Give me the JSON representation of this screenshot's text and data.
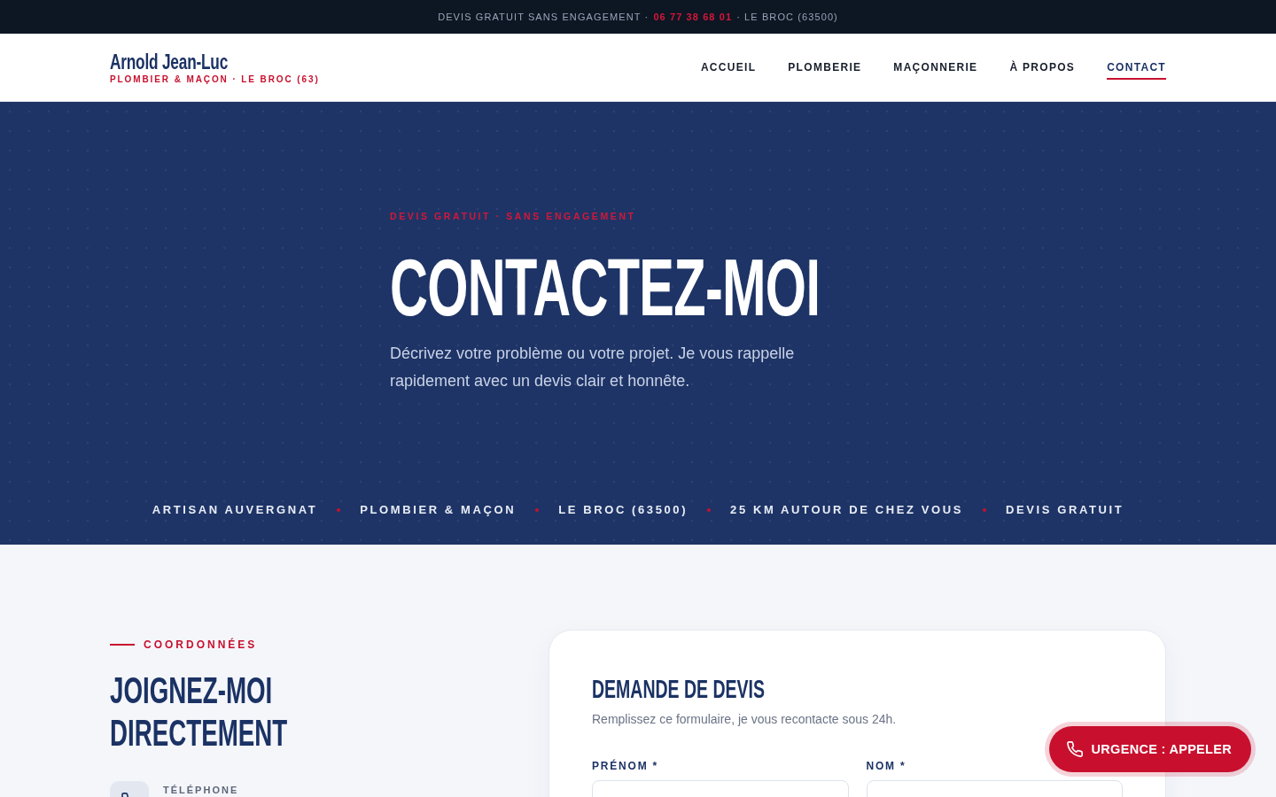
{
  "top_bar": {
    "text": "DEVIS GRATUIT SANS ENGAGEMENT ·",
    "phone": "06 77 38 68 01",
    "location": "· LE BROC (63500)"
  },
  "header": {
    "brand": {
      "name": "Arnold Jean-Luc",
      "tagline": "PLOMBIER & MAÇON · LE BROC (63)"
    },
    "nav": [
      {
        "label": "ACCUEIL",
        "selected": false
      },
      {
        "label": "PLOMBERIE",
        "selected": false
      },
      {
        "label": "MAÇONNERIE",
        "selected": false
      },
      {
        "label": "À PROPOS",
        "selected": false
      },
      {
        "label": "CONTACT",
        "selected": true
      }
    ]
  },
  "hero": {
    "eyebrow": "DEVIS GRATUIT · SANS ENGAGEMENT",
    "title": "CONTACTEZ-MOI",
    "description": "Décrivez votre problème ou votre projet. Je vous rappelle rapidement avec un devis clair et honnête.",
    "highlights": [
      "ARTISAN AUVERGNAT",
      "PLOMBIER & MAÇON",
      "LE BROC (63500)",
      "25 KM AUTOUR DE CHEZ VOUS",
      "DEVIS GRATUIT"
    ]
  },
  "contact_info": {
    "eyebrow": "COORDONNÉES",
    "title": "JOIGNEZ-MOI DIRECTEMENT",
    "items": [
      {
        "label": "TÉLÉPHONE"
      }
    ]
  },
  "quote_form": {
    "title": "DEMANDE DE DEVIS",
    "subtitle": "Remplissez ce formulaire, je vous recontacte sous 24h.",
    "fields": [
      {
        "label": "PRÉNOM *"
      },
      {
        "label": "NOM *"
      }
    ]
  },
  "emergency_button": {
    "label": "URGENCE : APPELER"
  }
}
